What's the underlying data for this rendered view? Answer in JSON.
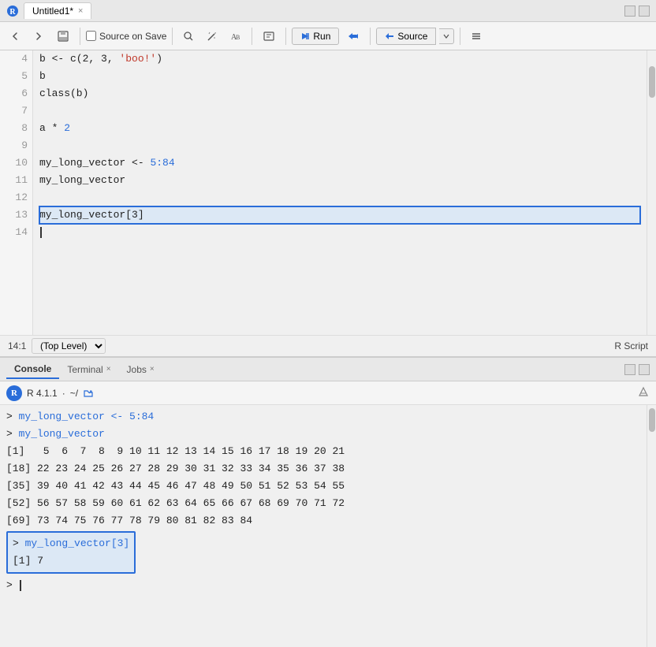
{
  "titlebar": {
    "title": "Untitled1*",
    "close": "×"
  },
  "toolbar": {
    "source_on_save_label": "Source on Save",
    "run_label": "Run",
    "source_label": "Source",
    "re_run_label": "Re-run"
  },
  "editor": {
    "lines": [
      {
        "num": "4",
        "code": "b <- c(2, 3, ",
        "string": "'boo!'",
        "after": ")"
      },
      {
        "num": "5",
        "code": "b",
        "string": "",
        "after": ""
      },
      {
        "num": "6",
        "code": "class(b)",
        "string": "",
        "after": ""
      },
      {
        "num": "7",
        "code": "",
        "string": "",
        "after": ""
      },
      {
        "num": "8",
        "code": "a * ",
        "string": "",
        "after": "",
        "highlight": "2"
      },
      {
        "num": "9",
        "code": "",
        "string": "",
        "after": ""
      },
      {
        "num": "10",
        "code": "my_long_vector <- ",
        "string": "",
        "after": "",
        "highlight": "5:84"
      },
      {
        "num": "11",
        "code": "my_long_vector",
        "string": "",
        "after": ""
      },
      {
        "num": "12",
        "code": "",
        "string": "",
        "after": ""
      },
      {
        "num": "13",
        "code": "my_long_vector[3]",
        "string": "",
        "after": "",
        "selected": true
      },
      {
        "num": "14",
        "code": "",
        "string": "",
        "after": ""
      }
    ],
    "status": {
      "position": "14:1",
      "scope": "(Top Level)",
      "type": "R Script"
    }
  },
  "console": {
    "tabs": [
      "Console",
      "Terminal",
      "Jobs"
    ],
    "r_version": "R 4.1.1",
    "working_dir": "~/",
    "lines": [
      {
        "type": "prompt_cmd",
        "text": "> my_long_vector <- 5:84"
      },
      {
        "type": "prompt_cmd",
        "text": "> my_long_vector"
      },
      {
        "type": "output",
        "text": "[1]   5  6  7  8  9 10 11 12 13 14 15 16 17 18 19 20 21"
      },
      {
        "type": "output",
        "text": "[18] 22 23 24 25 26 27 28 29 30 31 32 33 34 35 36 37 38"
      },
      {
        "type": "output",
        "text": "[35] 39 40 41 42 43 44 45 46 47 48 49 50 51 52 53 54 55"
      },
      {
        "type": "output",
        "text": "[52] 56 57 58 59 60 61 62 63 64 65 66 67 68 69 70 71 72"
      },
      {
        "type": "output",
        "text": "[69] 73 74 75 76 77 78 79 80 81 82 83 84"
      }
    ],
    "highlighted_cmd": "> my_long_vector[3]",
    "highlighted_result": "[1] 7",
    "prompt": ">"
  }
}
